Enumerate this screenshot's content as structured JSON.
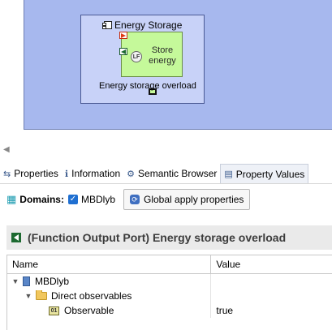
{
  "diagram": {
    "component": {
      "title": "Energy Storage",
      "function_label": "Store energy",
      "function_icon_text": "LF",
      "output_port_label": "Energy storage overload",
      "colors": {
        "canvas": "#a7b8ee",
        "component": "#c8d2f8",
        "function": "#c5f99a",
        "input_port": "#e03b14",
        "output_port": "#1d6a31"
      }
    }
  },
  "tabs": [
    {
      "label": "Properties",
      "icon": "properties-icon",
      "active": false
    },
    {
      "label": "Information",
      "icon": "information-icon",
      "active": false
    },
    {
      "label": "Semantic Browser",
      "icon": "semantic-browser-icon",
      "active": false
    },
    {
      "label": "Property Values",
      "icon": "property-values-icon",
      "active": true
    }
  ],
  "domains": {
    "label": "Domains:",
    "selected_domain": "MBDlyb",
    "checked": true,
    "global_button_label": "Global apply properties"
  },
  "section": {
    "title": "(Function Output Port) Energy storage overload"
  },
  "table": {
    "columns": {
      "name": "Name",
      "value": "Value"
    },
    "rows": [
      {
        "name": "MBDlyb",
        "value": "",
        "level": 0,
        "expanded": true,
        "icon": "model-icon"
      },
      {
        "name": "Direct observables",
        "value": "",
        "level": 1,
        "expanded": true,
        "icon": "folder-icon"
      },
      {
        "name": "Observable",
        "value": "true",
        "level": 2,
        "expanded": false,
        "icon": "observable-icon"
      }
    ]
  }
}
